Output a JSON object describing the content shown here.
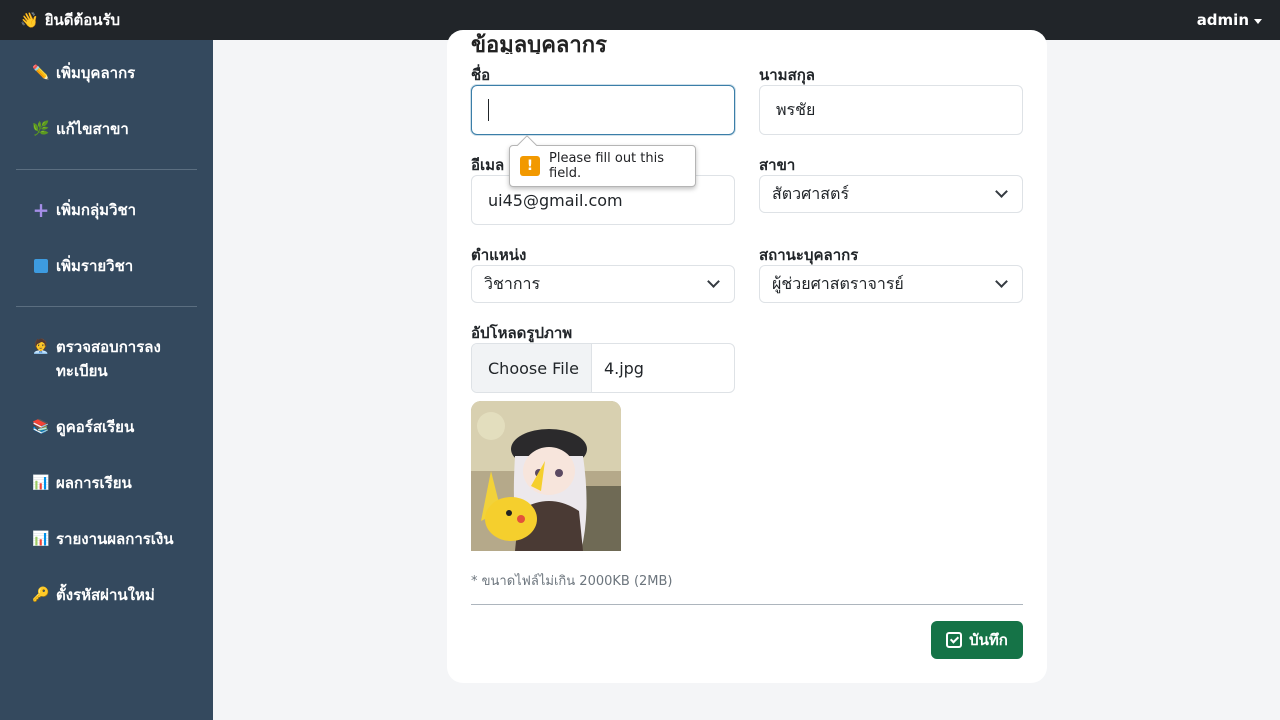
{
  "topbar": {
    "brand_icon": "waving-hand-icon",
    "brand_text": "ยินดีต้อนรับ",
    "user": "admin"
  },
  "sidebar": {
    "items": [
      {
        "icon": "pencil-icon",
        "label": "เพิ่มบุคลากร"
      },
      {
        "icon": "seedling-icon",
        "label": "แก้ไขสาขา"
      },
      {
        "icon": "plus-icon",
        "label": "เพิ่มกลุ่มวิชา"
      },
      {
        "icon": "book-icon",
        "label": "เพิ่มรายวิชา"
      },
      {
        "icon": "person-at-desk-icon",
        "label": "ตรวจสอบการลงทะเบียน"
      },
      {
        "icon": "books-icon",
        "label": "ดูคอร์สเรียน"
      },
      {
        "icon": "bar-chart-icon",
        "label": "ผลการเรียน"
      },
      {
        "icon": "bar-chart-icon",
        "label": "รายงานผลการเงิน"
      },
      {
        "icon": "key-icon",
        "label": "ตั้งรหัสผ่านใหม่"
      }
    ]
  },
  "form": {
    "title": "ข้อมูลบุคลากร",
    "first_name": {
      "label": "ชื่อ",
      "value": ""
    },
    "last_name": {
      "label": "นามสกุล",
      "value": "พรชัย"
    },
    "email": {
      "label": "อีเมล",
      "value": "ui45@gmail.com"
    },
    "branch": {
      "label": "สาขา",
      "value": "สัตวศาสตร์"
    },
    "position": {
      "label": "ตำแหน่ง",
      "value": "วิชาการ"
    },
    "staff_status": {
      "label": "สถานะบุคลากร",
      "value": "ผู้ช่วยศาสตราจารย์"
    },
    "upload": {
      "label": "อัปโหลดรูปภาพ",
      "button": "Choose File",
      "file_name": "4.jpg"
    },
    "note": "* ขนาดไฟล์ไม่เกิน 2000KB (2MB)",
    "save_label": "บันทึก"
  },
  "tooltip": {
    "text": "Please fill out this field."
  },
  "colors": {
    "topbar": "#212529",
    "sidebar": "#34495e",
    "save": "#157347",
    "warning": "#f29900"
  }
}
